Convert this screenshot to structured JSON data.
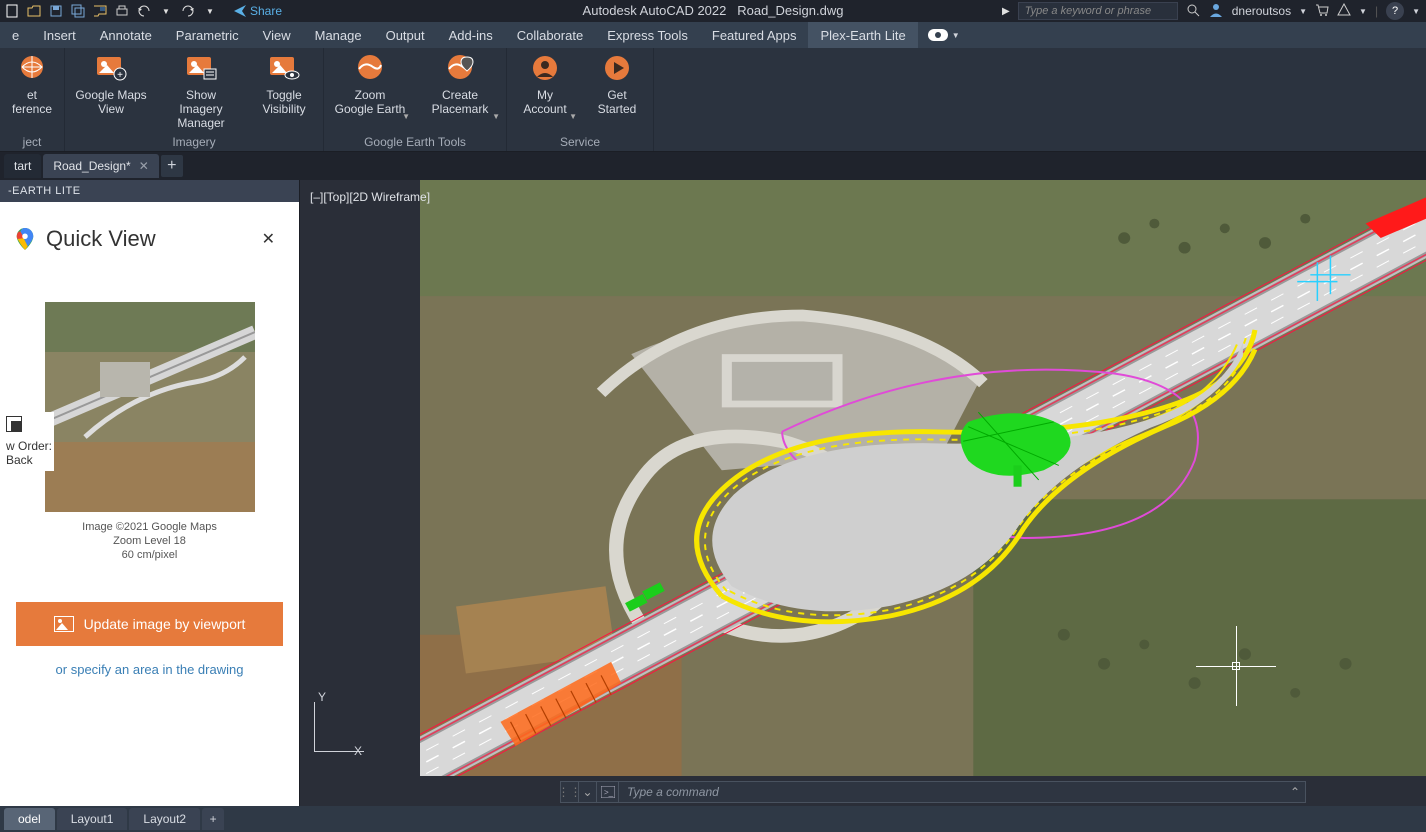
{
  "qat": {
    "share": "Share"
  },
  "title": {
    "app": "Autodesk AutoCAD 2022",
    "file": "Road_Design.dwg"
  },
  "search": {
    "placeholder": "Type a keyword or phrase"
  },
  "user": {
    "name": "dneroutsos"
  },
  "menus": [
    "e",
    "Insert",
    "Annotate",
    "Parametric",
    "View",
    "Manage",
    "Output",
    "Add-ins",
    "Collaborate",
    "Express Tools",
    "Featured Apps",
    "Plex-Earth Lite"
  ],
  "active_menu": 11,
  "ribbon": {
    "panels": [
      {
        "title": "ject",
        "items": [
          {
            "line1": "et",
            "line2": "ference"
          }
        ]
      },
      {
        "title": "Imagery",
        "items": [
          {
            "line1": "Google Maps",
            "line2": "View"
          },
          {
            "line1": "Show Imagery",
            "line2": "Manager"
          },
          {
            "line1": "Toggle",
            "line2": "Visibility"
          }
        ]
      },
      {
        "title": "Google Earth Tools",
        "items": [
          {
            "line1": "Zoom",
            "line2": "Google Earth",
            "dd": true
          },
          {
            "line1": "Create",
            "line2": "Placemark",
            "dd": true
          }
        ]
      },
      {
        "title": "Service",
        "items": [
          {
            "line1": "My",
            "line2": "Account",
            "dd": true,
            "ico": "user"
          },
          {
            "line1": "Get",
            "line2": "Started",
            "ico": "play"
          }
        ]
      }
    ]
  },
  "doc_tabs": {
    "start": "tart",
    "file": "Road_Design*"
  },
  "side": {
    "header": "-EARTH LITE",
    "title": "Quick View",
    "caption1": "Image ©2021 Google Maps",
    "caption2": "Zoom Level 18",
    "caption3": "60 cm/pixel",
    "draw_order1": "w Order:",
    "draw_order2": "Back",
    "button": "Update image by viewport",
    "link": "or specify an area in the drawing"
  },
  "viewport": {
    "label": "[–][Top][2D Wireframe]",
    "y": "Y",
    "x": "X"
  },
  "command": {
    "placeholder": "Type a command"
  },
  "footer": {
    "model": "odel",
    "l1": "Layout1",
    "l2": "Layout2"
  }
}
